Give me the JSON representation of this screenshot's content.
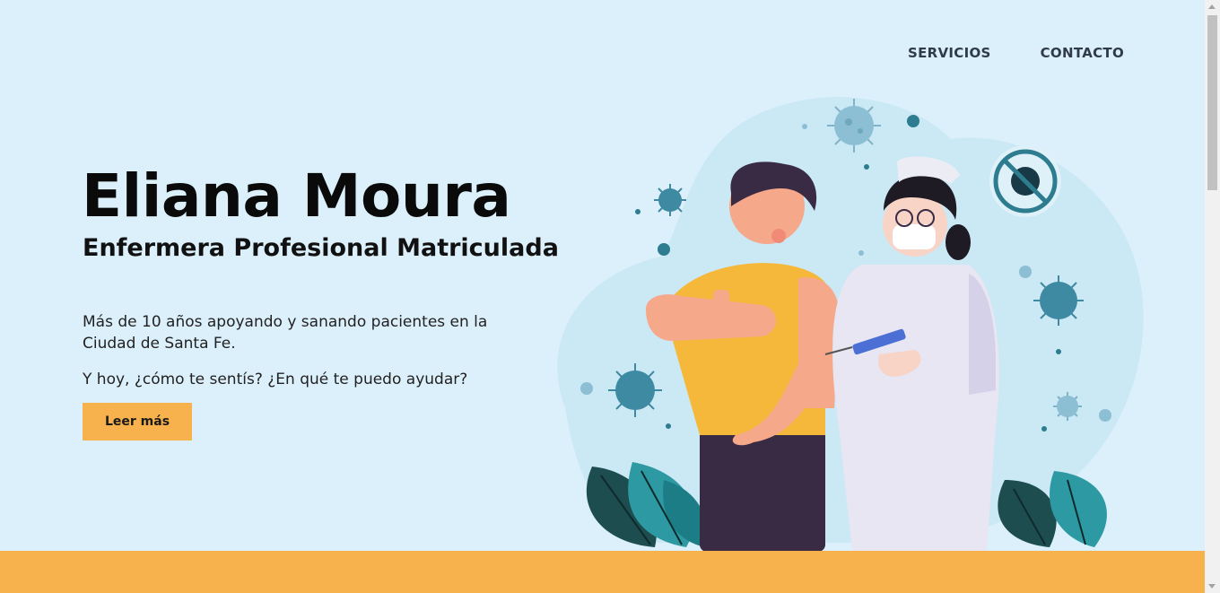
{
  "nav": {
    "items": [
      "SERVICIOS",
      "CONTACTO"
    ]
  },
  "hero": {
    "name": "Eliana Moura",
    "role": "Enfermera Profesional Matriculada",
    "intro": "Más de 10 años apoyando y sanando pacientes en la Ciudad de Santa Fe.",
    "question": "Y hoy, ¿cómo te sentís? ¿En qué te puedo ayudar?",
    "cta_label": "Leer más"
  },
  "colors": {
    "background": "#dcf0fb",
    "accent": "#f7b24d",
    "nav_text": "#2f3b48",
    "heading": "#0a0a0a"
  },
  "illustration": {
    "icon": "vaccination-illustration",
    "subject": "nurse vaccinating patient with virus particles"
  }
}
